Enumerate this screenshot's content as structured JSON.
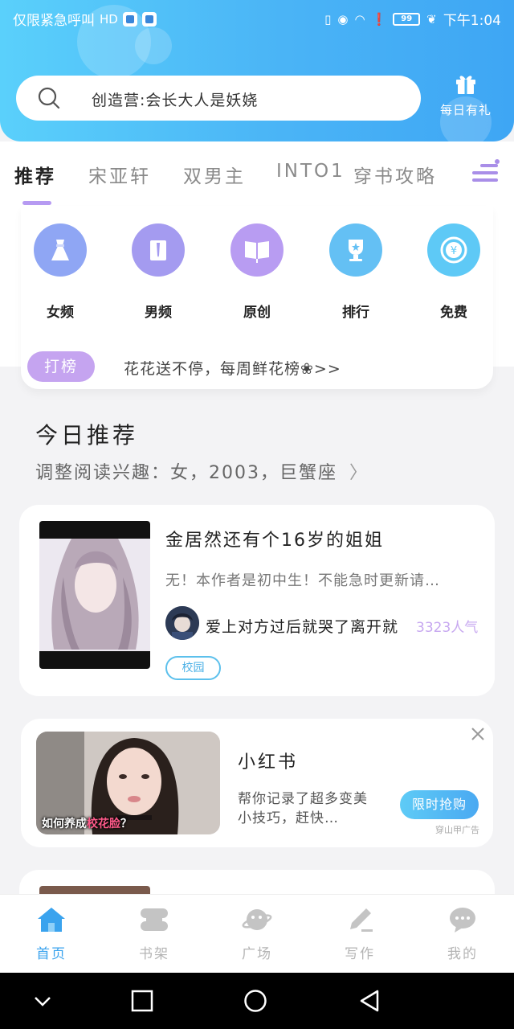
{
  "status_bar": {
    "left_text": "仅限紧急呼叫",
    "hd_label": "HD",
    "battery": "99",
    "time": "下午1:04"
  },
  "search": {
    "placeholder": "创造营:会长大人是妖娆"
  },
  "daily_gift": {
    "label": "每日有礼"
  },
  "tabs": [
    {
      "label": "推荐",
      "active": true
    },
    {
      "label": "宋亚轩"
    },
    {
      "label": "双男主"
    },
    {
      "label": "INTO1"
    },
    {
      "label": "穿书攻略"
    }
  ],
  "categories": [
    {
      "label": "女频",
      "icon": "dress-icon",
      "color": "#8fa6f4"
    },
    {
      "label": "男频",
      "icon": "shirt-icon",
      "color": "#a49bf0"
    },
    {
      "label": "原创",
      "icon": "book-icon",
      "color": "#b89cf2"
    },
    {
      "label": "排行",
      "icon": "trophy-icon",
      "color": "#64c0f4"
    },
    {
      "label": "免费",
      "icon": "coin-icon",
      "color": "#5ec9f6"
    }
  ],
  "ranking": {
    "tag": "打榜",
    "text": "花花送不停，每周鲜花榜❀>>"
  },
  "today": {
    "title": "今日推荐",
    "subtitle": "调整阅读兴趣：女，2003，巨蟹座"
  },
  "book": {
    "title": "金居然还有个16岁的姐姐",
    "description": "无！本作者是初中生！不能急时更新请…",
    "author": "爱上对方过后就哭了离开就",
    "popularity": "3323人气",
    "tag": "校园"
  },
  "ad": {
    "title": "小红书",
    "description": "帮你记录了超多变美小技巧，赶快…",
    "cta": "限时抢购",
    "source": "穿山甲广告",
    "caption_prefix": "如何养成",
    "caption_highlight": "校花脸",
    "caption_suffix": "？"
  },
  "bottom_nav": [
    {
      "label": "首页",
      "icon": "home-icon",
      "active": true
    },
    {
      "label": "书架",
      "icon": "bookshelf-icon"
    },
    {
      "label": "广场",
      "icon": "planet-icon"
    },
    {
      "label": "写作",
      "icon": "pen-icon"
    },
    {
      "label": "我的",
      "icon": "chat-bubble-icon"
    }
  ],
  "colors": {
    "header_start": "#5ad0fb",
    "header_end": "#3ea6f4",
    "accent_purple": "#c5a4f0",
    "active_blue": "#3aa3ee"
  }
}
